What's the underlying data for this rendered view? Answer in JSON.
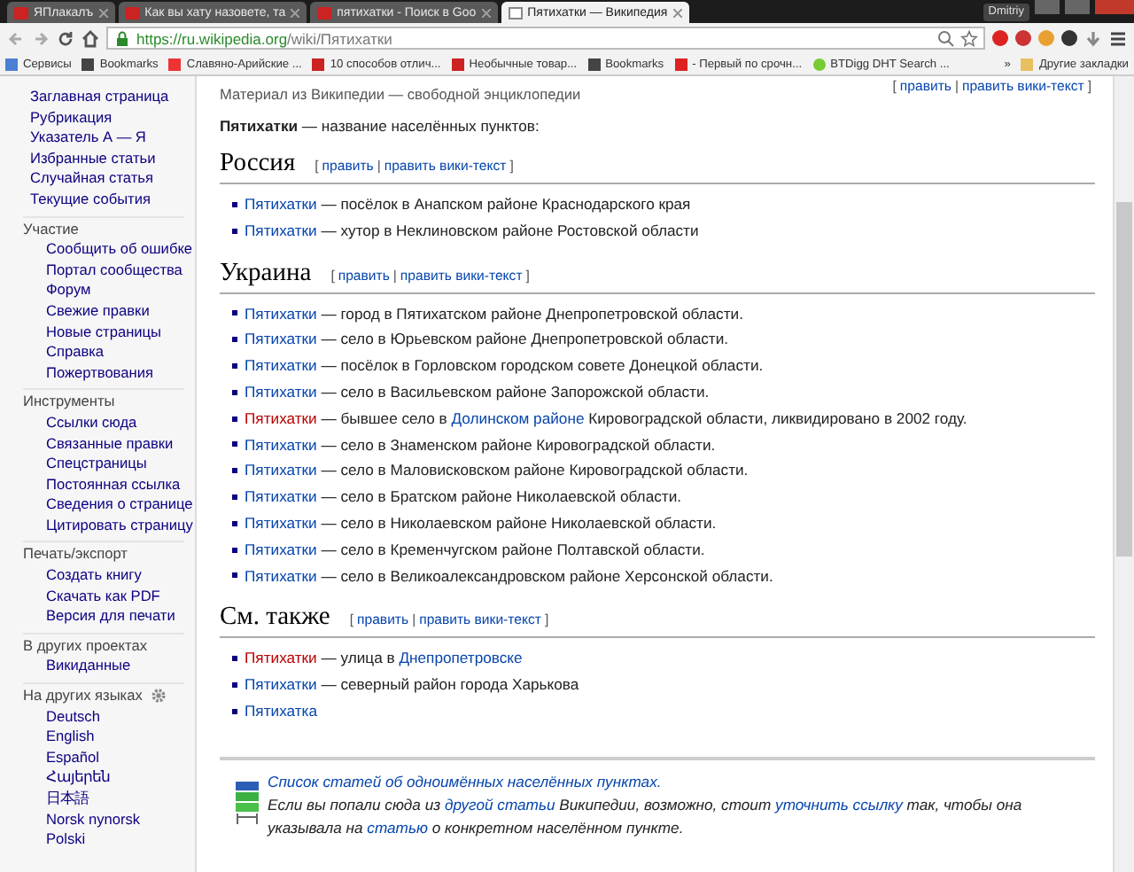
{
  "browser": {
    "tabs": [
      {
        "label": "ЯПлакалъ",
        "selected": false
      },
      {
        "label": "Как вы хату назовете, та",
        "selected": false
      },
      {
        "label": "пятихатки - Поиск в Goo",
        "selected": false
      },
      {
        "label": "Пятихатки — Википедия",
        "selected": true
      }
    ],
    "user": "Dmitriy",
    "url_host": "https://ru.wikipedia.org",
    "url_path": "/wiki/Пятихатки",
    "bookmarks": [
      "Сервисы",
      "Bookmarks",
      "Славяно-Арийские ...",
      "10 способов отлич...",
      "Необычные товар...",
      "Bookmarks",
      "- Первый по срочн...",
      "BTDigg DHT Search ..."
    ],
    "more": "»",
    "other_bookmarks": "Другие закладки"
  },
  "sidebar": {
    "top": [
      "Заглавная страница",
      "Рубрикация",
      "Указатель А — Я",
      "Избранные статьи",
      "Случайная статья",
      "Текущие события"
    ],
    "sections": [
      {
        "title": "Участие",
        "items": [
          "Сообщить об ошибке",
          "Портал сообщества",
          "Форум",
          "Свежие правки",
          "Новые страницы",
          "Справка",
          "Пожертвования"
        ]
      },
      {
        "title": "Инструменты",
        "items": [
          "Ссылки сюда",
          "Связанные правки",
          "Спецстраницы",
          "Постоянная ссылка",
          "Сведения о странице",
          "Цитировать страницу"
        ]
      },
      {
        "title": "Печать/экспорт",
        "items": [
          "Создать книгу",
          "Скачать как PDF",
          "Версия для печати"
        ]
      },
      {
        "title": "В других проектах",
        "items": [
          "Викиданные"
        ]
      },
      {
        "title": "На других языках",
        "settings": true,
        "items": [
          "Deutsch",
          "English",
          "Español",
          "Հայերեն",
          "日本語",
          "Norsk nynorsk",
          "Polski"
        ]
      }
    ]
  },
  "article": {
    "tagline": "Материал из Википедии — свободной энциклопедии",
    "edit_links": [
      {
        "kind": "punct",
        "text": "["
      },
      {
        "kind": "link",
        "text": "править"
      },
      {
        "kind": "punct",
        "text": "|"
      },
      {
        "kind": "link",
        "text": "править вики-текст"
      },
      {
        "kind": "punct",
        "text": "]"
      }
    ],
    "intro": "**Пятихатки** — название населённых пунктов:",
    "sections": [
      {
        "title": "Россия",
        "edit_links": [
          {
            "kind": "punct",
            "text": "["
          },
          {
            "kind": "link",
            "text": "править"
          },
          {
            "kind": "punct",
            "text": "|"
          },
          {
            "kind": "link",
            "text": "править вики-текст"
          },
          {
            "kind": "punct",
            "text": "]"
          }
        ],
        "items": [
          [
            {
              "kind": "link",
              "text": "Пятихатки"
            },
            {
              "kind": "text",
              "text": " — посёлок в Анапском районе Краснодарского края"
            }
          ],
          [
            {
              "kind": "link",
              "text": "Пятихатки"
            },
            {
              "kind": "text",
              "text": " — хутор в Неклиновском районе Ростовской области"
            }
          ]
        ]
      },
      {
        "title": "Украина",
        "edit_links": [
          {
            "kind": "punct",
            "text": "["
          },
          {
            "kind": "link",
            "text": "править"
          },
          {
            "kind": "punct",
            "text": "|"
          },
          {
            "kind": "link",
            "text": "править вики-текст"
          },
          {
            "kind": "punct",
            "text": "]"
          }
        ],
        "items": [
          [
            {
              "kind": "link",
              "text": "Пятихатки"
            },
            {
              "kind": "text",
              "text": " — город в Пятихатском районе Днепропетровской области."
            }
          ],
          [
            {
              "kind": "link",
              "text": "Пятихатки"
            },
            {
              "kind": "text",
              "text": " — село в Юрьевском районе Днепропетровской области."
            }
          ],
          [
            {
              "kind": "link",
              "text": "Пятихатки"
            },
            {
              "kind": "text",
              "text": " — посёлок в Горловском городском совете Донецкой области."
            }
          ],
          [
            {
              "kind": "link",
              "text": "Пятихатки"
            },
            {
              "kind": "text",
              "text": " — село в Васильевском районе Запорожской области."
            }
          ],
          [
            {
              "kind": "redlink",
              "text": "Пятихатки"
            },
            {
              "kind": "text",
              "text": " — бывшее село в "
            },
            {
              "kind": "link",
              "text": "Долинском районе"
            },
            {
              "kind": "text",
              "text": " Кировоградской области, ликвидировано в 2002 году."
            }
          ],
          [
            {
              "kind": "link",
              "text": "Пятихатки"
            },
            {
              "kind": "text",
              "text": " — село в Знаменском районе Кировоградской области."
            }
          ],
          [
            {
              "kind": "link",
              "text": "Пятихатки"
            },
            {
              "kind": "text",
              "text": " — село в Маловисковском районе Кировоградской области."
            }
          ],
          [
            {
              "kind": "link",
              "text": "Пятихатки"
            },
            {
              "kind": "text",
              "text": " — село в Братском районе Николаевской области."
            }
          ],
          [
            {
              "kind": "link",
              "text": "Пятихатки"
            },
            {
              "kind": "text",
              "text": " — село в Николаевском районе Николаевской области."
            }
          ],
          [
            {
              "kind": "link",
              "text": "Пятихатки"
            },
            {
              "kind": "text",
              "text": " — село в Кременчугском районе Полтавской области."
            }
          ],
          [
            {
              "kind": "link",
              "text": "Пятихатки"
            },
            {
              "kind": "text",
              "text": " — село в Великоалександровском районе Херсонской области."
            }
          ]
        ]
      },
      {
        "title": "См. также",
        "edit_links": [
          {
            "kind": "punct",
            "text": "["
          },
          {
            "kind": "link",
            "text": "править"
          },
          {
            "kind": "punct",
            "text": "|"
          },
          {
            "kind": "link",
            "text": "править вики-текст"
          },
          {
            "kind": "punct",
            "text": "]"
          }
        ],
        "items": [
          [
            {
              "kind": "redlink",
              "text": "Пятихатки"
            },
            {
              "kind": "text",
              "text": " — улица в "
            },
            {
              "kind": "link",
              "text": "Днепропетровске"
            }
          ],
          [
            {
              "kind": "link",
              "text": "Пятихатки"
            },
            {
              "kind": "text",
              "text": " — северный район города Харькова"
            }
          ],
          [
            {
              "kind": "link",
              "text": "Пятихатка"
            }
          ]
        ]
      }
    ],
    "notice": [
      [
        {
          "kind": "link",
          "text": "Список статей об одноимённых населённых пунктах."
        }
      ],
      [
        {
          "kind": "text",
          "text": "Если вы попали сюда из "
        },
        {
          "kind": "link",
          "text": "другой статьи"
        },
        {
          "kind": "text",
          "text": " Википедии, возможно, стоит "
        },
        {
          "kind": "link",
          "text": "уточнить ссылку"
        },
        {
          "kind": "text",
          "text": " так, чтобы она указывала на "
        },
        {
          "kind": "link",
          "text": "статью"
        },
        {
          "kind": "text",
          "text": " о конкретном населённом пункте."
        }
      ]
    ]
  }
}
